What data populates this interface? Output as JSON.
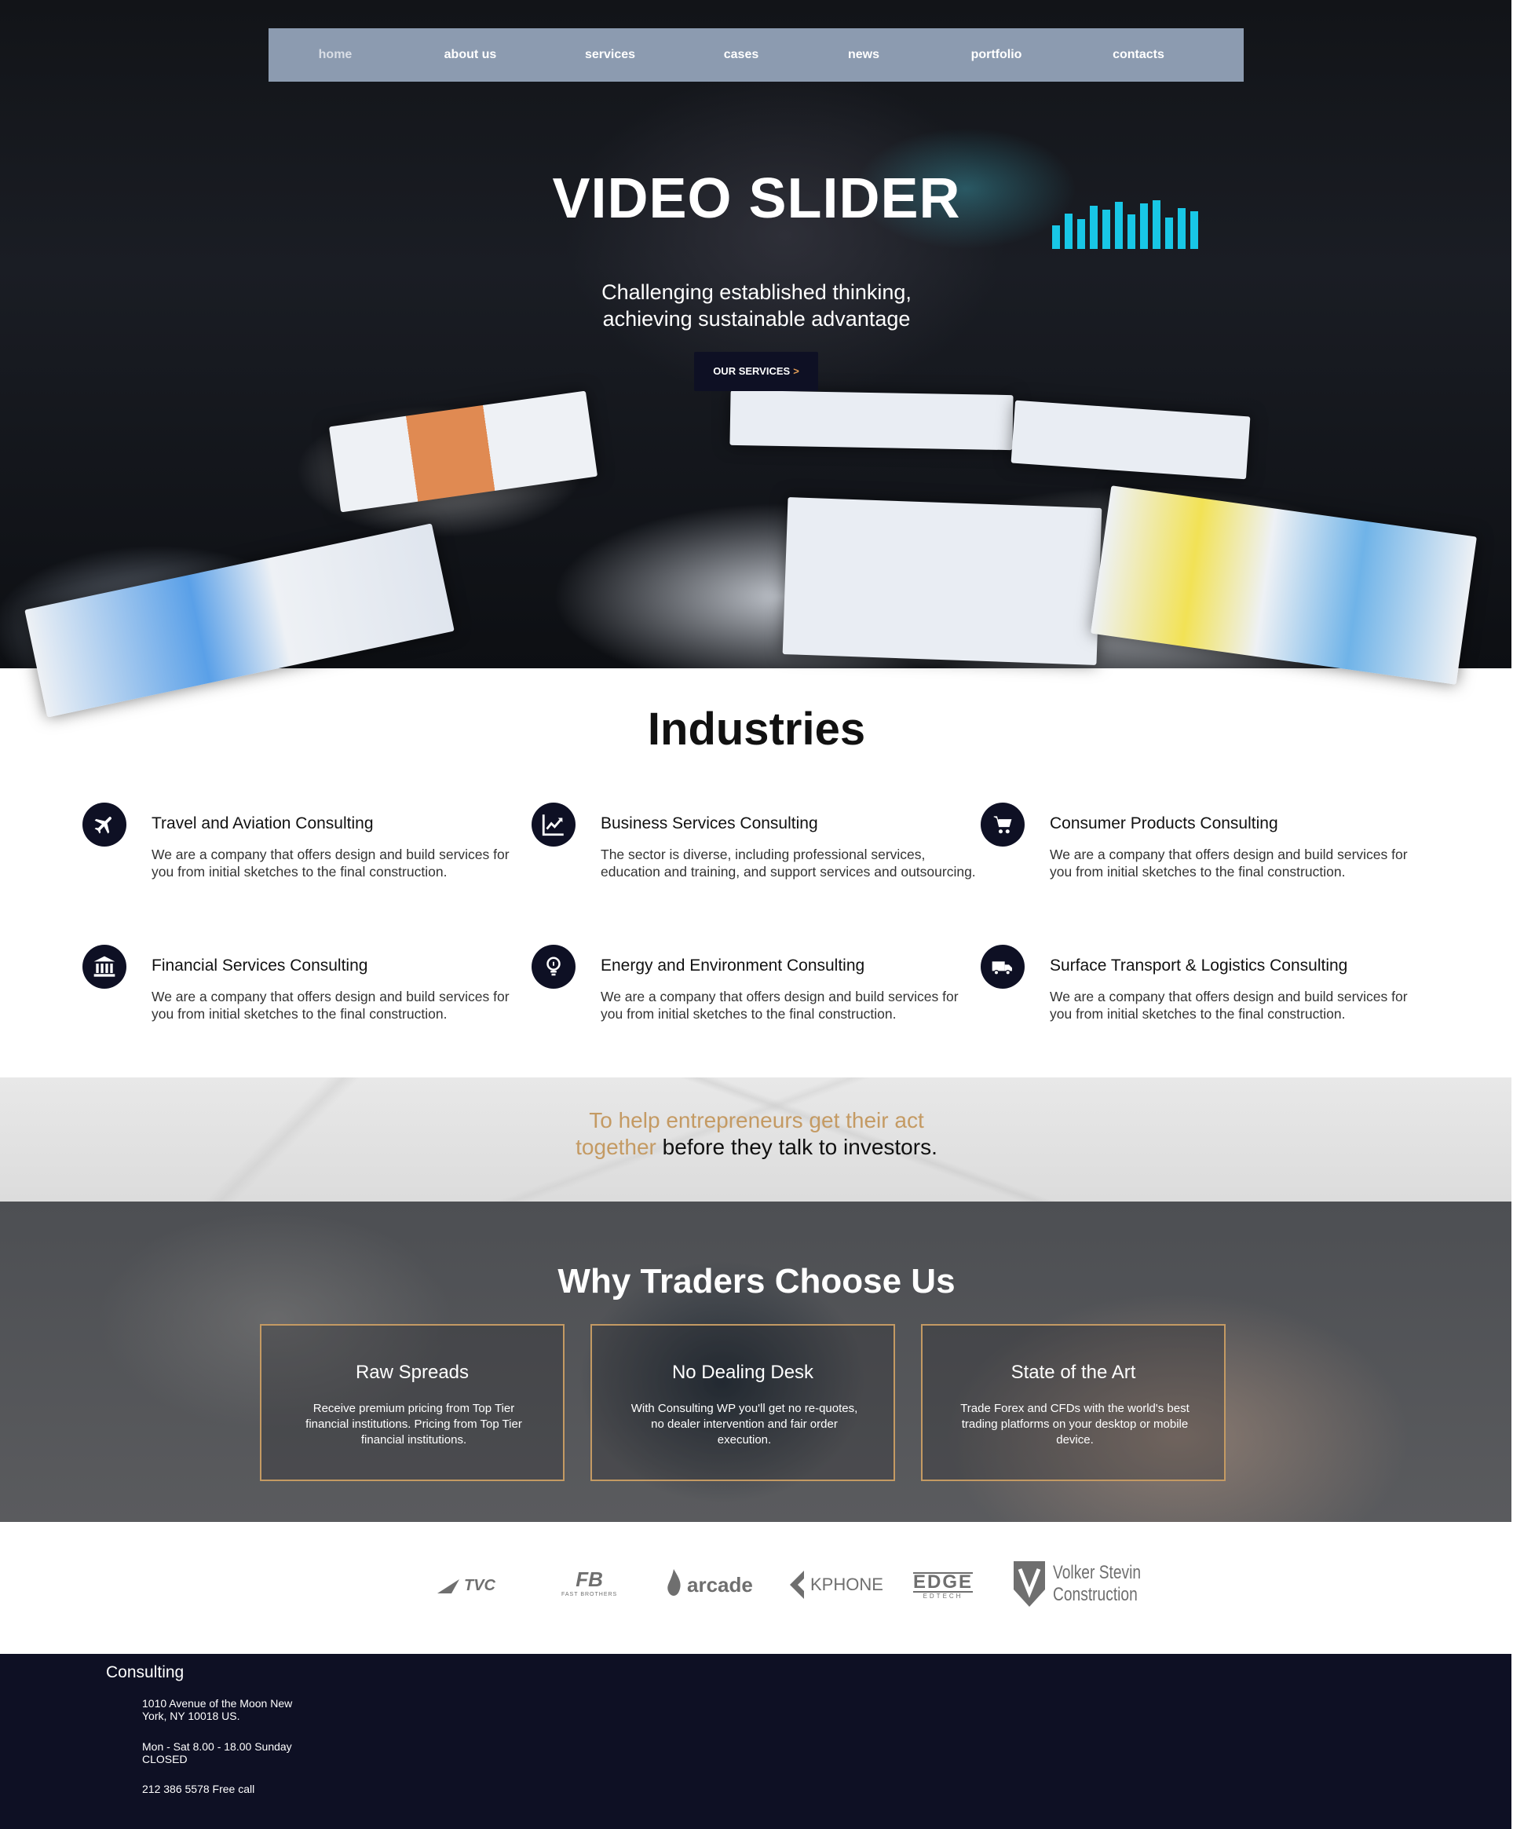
{
  "nav": {
    "items": [
      "home",
      "about us",
      "services",
      "cases",
      "news",
      "portfolio",
      "contacts"
    ],
    "active": "home"
  },
  "hero": {
    "title": "VIDEO SLIDER",
    "subtitle_line1": "Challenging established thinking,",
    "subtitle_line2": "achieving sustainable advantage",
    "button_label": "OUR SERVICES",
    "button_chevron": ">"
  },
  "industries": {
    "title": "Industries",
    "items": [
      {
        "icon": "airplane-icon",
        "name": "Travel and Aviation Consulting",
        "desc": "We are a company that offers design and build services for you from initial sketches to the final construction."
      },
      {
        "icon": "chart-up-icon",
        "name": "Business Services Consulting",
        "desc": "The sector is diverse, including professional services, education and training, and support services and outsourcing."
      },
      {
        "icon": "cart-icon",
        "name": "Consumer Products Consulting",
        "desc": "We are a company that offers design and build services for you from initial sketches to the final construction."
      },
      {
        "icon": "bank-icon",
        "name": "Financial Services Consulting",
        "desc": "We are a company that offers design and build services for you from initial sketches to the final construction."
      },
      {
        "icon": "lightbulb-icon",
        "name": "Energy and Environment Consulting",
        "desc": "We are a company that offers design and build services for you from initial sketches to the final construction."
      },
      {
        "icon": "truck-icon",
        "name": "Surface Transport & Logistics Consulting",
        "desc": "We are a company that offers design and build services for you from initial sketches to the final construction."
      }
    ]
  },
  "quote": {
    "gold_line1": "To help entrepreneurs get their act",
    "gold_line2": "together",
    "dark_line2": " before they talk to investors."
  },
  "why": {
    "title": "Why Traders Choose Us",
    "cards": [
      {
        "title": "Raw Spreads",
        "text": "Receive premium pricing from Top Tier financial institutions. Pricing from Top Tier financial institutions."
      },
      {
        "title": "No Dealing Desk",
        "text": "With Consulting WP you'll get no re-quotes, no dealer intervention and fair order execution."
      },
      {
        "title": "State of the Art",
        "text": "Trade Forex and CFDs with the world's best trading platforms on your desktop or mobile device."
      }
    ]
  },
  "logos": {
    "tvc": "TVC",
    "fast_brothers": "FAST BROTHERS",
    "arcade": "arcade",
    "kphone": "KPHONE",
    "edge": "EDGE",
    "edge_sub": "EDTECH",
    "volker_line1": "Volker Stevin",
    "volker_line2": "Construction"
  },
  "footer": {
    "title": "Consulting",
    "address_line1": "1010 Avenue of the Moon New",
    "address_line2": "York, NY 10018 US.",
    "hours_line1": "Mon - Sat 8.00 - 18.00 Sunday",
    "hours_line2": "CLOSED",
    "phone": "212 386 5578 Free call"
  },
  "colors": {
    "navy": "#0e1024",
    "gold": "#c49a63",
    "nav_bg": "#8c9bb0",
    "accent_chevron": "#e6a15a"
  }
}
